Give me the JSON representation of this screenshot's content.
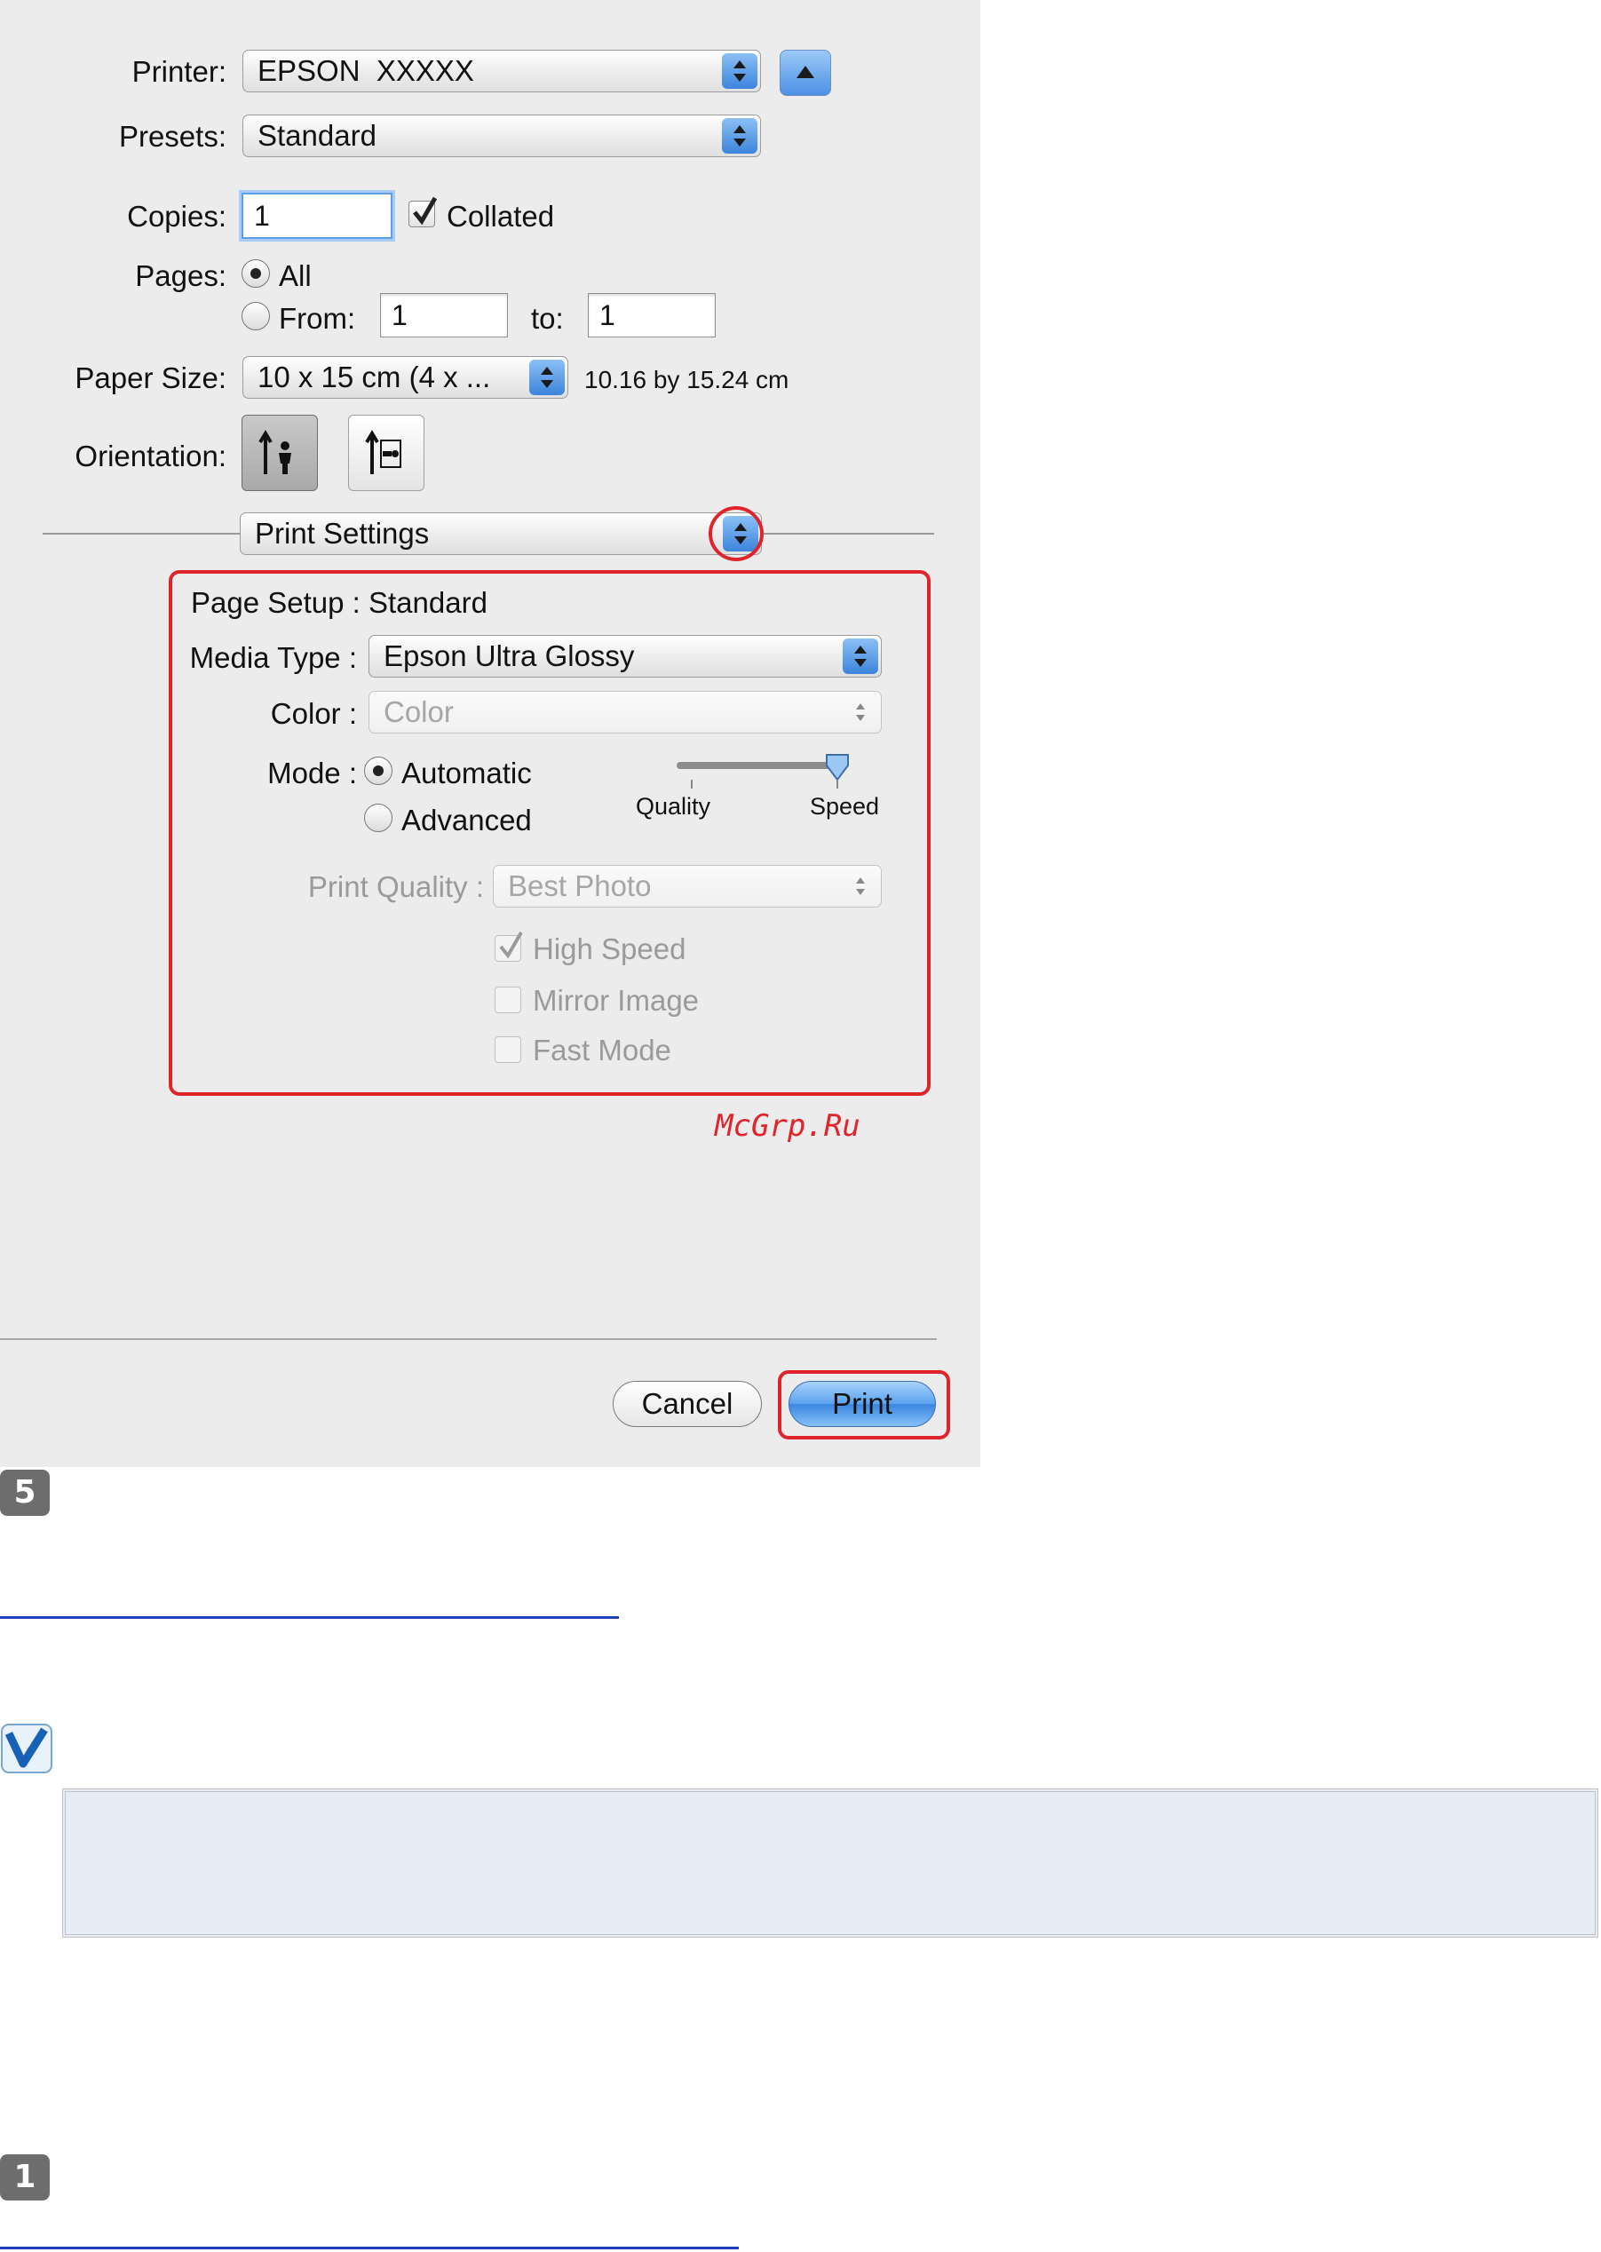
{
  "dialog": {
    "printer": {
      "label": "Printer:",
      "value": "EPSON  XXXXX"
    },
    "presets": {
      "label": "Presets:",
      "value": "Standard"
    },
    "copies": {
      "label": "Copies:",
      "value": "1",
      "collated_label": "Collated",
      "collated": true
    },
    "pages": {
      "label": "Pages:",
      "all_label": "All",
      "from_label": "From:",
      "from_value": "1",
      "to_label": "to:",
      "to_value": "1"
    },
    "paper_size": {
      "label": "Paper Size:",
      "value": "10 x 15 cm (4 x ...",
      "dimensions": "10.16 by 15.24 cm"
    },
    "orientation": {
      "label": "Orientation:"
    },
    "section_popup": "Print Settings",
    "settings": {
      "page_setup": "Page Setup : Standard",
      "media_type_label": "Media Type :",
      "media_type_value": "Epson Ultra Glossy",
      "color_label": "Color :",
      "color_value": "Color",
      "mode_label": "Mode :",
      "mode_automatic": "Automatic",
      "mode_advanced": "Advanced",
      "slider_quality": "Quality",
      "slider_speed": "Speed",
      "slider_level": 1.0,
      "print_quality_label": "Print Quality :",
      "print_quality_value": "Best Photo",
      "high_speed": "High Speed",
      "mirror_image": "Mirror Image",
      "fast_mode": "Fast Mode"
    },
    "watermark": "McGrp.Ru",
    "cancel": "Cancel",
    "print": "Print"
  },
  "steps": [
    {
      "number": "5"
    },
    {
      "number": "1"
    }
  ],
  "colors": {
    "highlight": "#e0242b",
    "link": "#1f3fc0",
    "note_bg": "#e8ecf6"
  }
}
